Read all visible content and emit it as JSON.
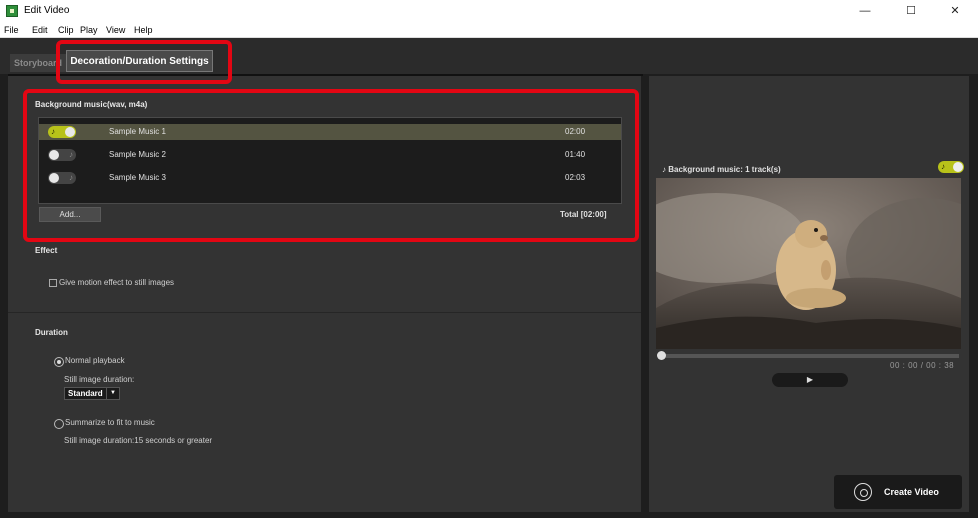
{
  "window": {
    "title": "Edit Video",
    "minimize": "—",
    "maximize": "☐",
    "close": "✕"
  },
  "menu": [
    "File",
    "Edit",
    "Clip",
    "Play",
    "View",
    "Help"
  ],
  "tabs": {
    "storyboard": "Storyboard",
    "decoration": "Decoration/Duration Settings"
  },
  "background_music": {
    "title": "Background music(wav, m4a)",
    "tracks": [
      {
        "name": "Sample Music 1",
        "duration": "02:00",
        "enabled": true
      },
      {
        "name": "Sample Music 2",
        "duration": "01:40",
        "enabled": false
      },
      {
        "name": "Sample Music 3",
        "duration": "02:03",
        "enabled": false
      }
    ],
    "add_label": "Add...",
    "total": "Total [02:00]"
  },
  "effect": {
    "title": "Effect",
    "motion_label": "Give motion effect to still images"
  },
  "duration": {
    "title": "Duration",
    "normal_label": "Normal playback",
    "still_duration_label": "Still image duration:",
    "still_duration_value": "Standard",
    "summarize_label": "Summarize to fit to music",
    "summarize_note": "Still image duration:15 seconds or greater"
  },
  "preview": {
    "bgm_status": "Background music: 1 track(s)",
    "timecode": "00 : 00  /  00 : 38",
    "play_icon": "▶",
    "create_label": "Create Video"
  },
  "colors": {
    "highlight": "#e30613",
    "toggle_on": "#b8c21a"
  }
}
